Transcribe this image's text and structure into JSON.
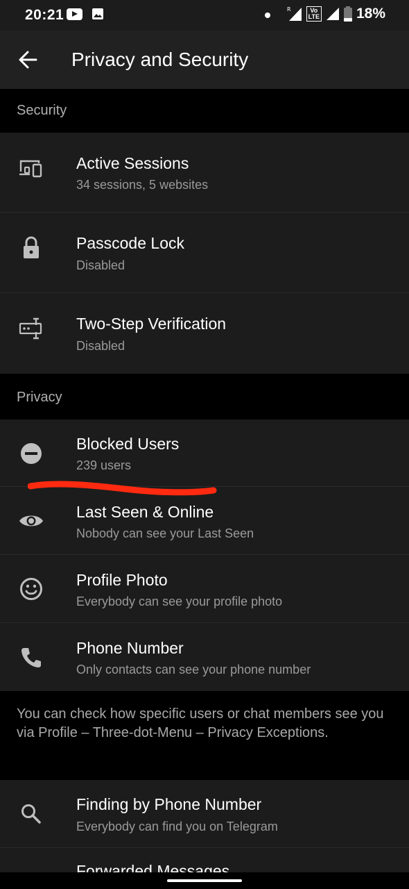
{
  "status_bar": {
    "time": "20:21",
    "battery": "18%",
    "network_badge": "Vo LTE",
    "roaming": "R"
  },
  "app_bar": {
    "title": "Privacy and Security"
  },
  "sections": {
    "security": "Security",
    "privacy": "Privacy"
  },
  "security_items": [
    {
      "label": "Active Sessions",
      "sub": "34 sessions, 5 websites",
      "icon": "devices-icon"
    },
    {
      "label": "Passcode Lock",
      "sub": "Disabled",
      "icon": "lock-icon"
    },
    {
      "label": "Two-Step Verification",
      "sub": "Disabled",
      "icon": "two-step-icon"
    }
  ],
  "privacy_items": [
    {
      "label": "Blocked Users",
      "sub": "239 users",
      "icon": "minus-circle-icon"
    },
    {
      "label": "Last Seen & Online",
      "sub": "Nobody can see your Last Seen",
      "icon": "eye-icon"
    },
    {
      "label": "Profile Photo",
      "sub": "Everybody can see your profile photo",
      "icon": "smiley-icon"
    },
    {
      "label": "Phone Number",
      "sub": "Only contacts can see your phone number",
      "icon": "phone-icon"
    }
  ],
  "info_text": "You can check how specific users or chat members see you via Profile – Three-dot-Menu – Privacy Exceptions.",
  "more_items": [
    {
      "label": "Finding by Phone Number",
      "sub": "Everybody can find you on Telegram",
      "icon": "search-icon"
    },
    {
      "label": "Forwarded Messages",
      "sub": "",
      "icon": ""
    }
  ],
  "colors": {
    "background": "#000000",
    "row": "#1c1c1c",
    "app_bar": "#212121",
    "secondary_text": "#9a9a9a",
    "annotation": "#ff2a10"
  }
}
